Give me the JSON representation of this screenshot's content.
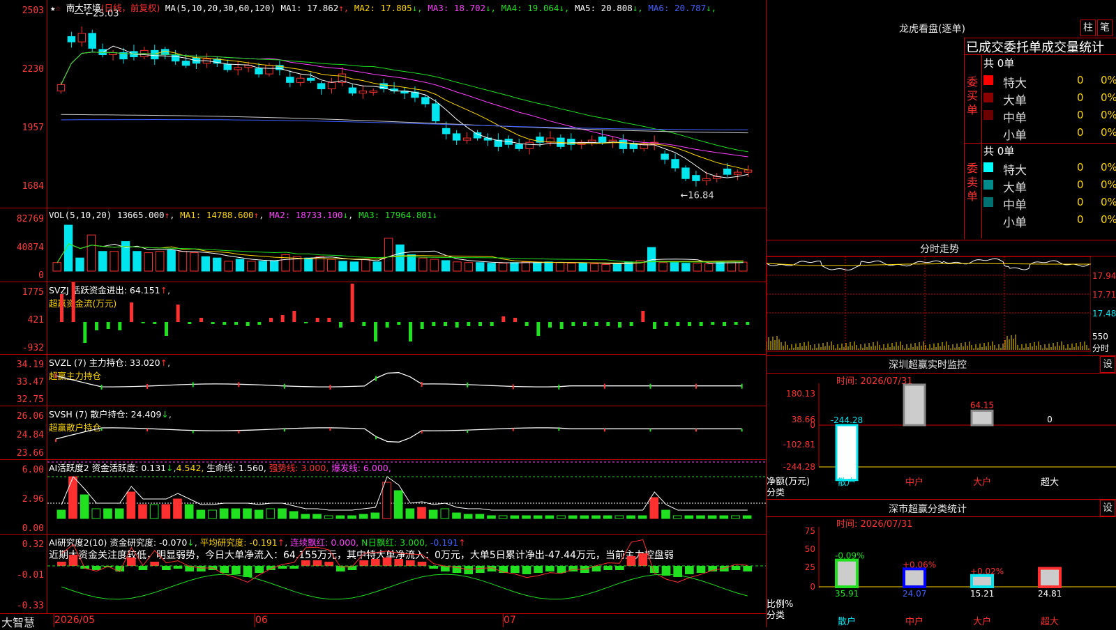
{
  "stock": {
    "name": "南大环境",
    "period": "(日线，前复权)"
  },
  "main_header": {
    "ma_prefix": "MA(5,10,20,30,60,120)",
    "ma": [
      {
        "label": "MA1:",
        "value": "17.862",
        "arrow": "↑",
        "color": "#ffffff"
      },
      {
        "label": "MA2:",
        "value": "17.805",
        "arrow": "↓",
        "color": "#ffd700"
      },
      {
        "label": "MA3:",
        "value": "18.702",
        "arrow": "↓",
        "color": "#ff40ff"
      },
      {
        "label": "MA4:",
        "value": "19.064",
        "arrow": "↓",
        "color": "#20e020"
      },
      {
        "label": "MA5:",
        "value": "20.808",
        "arrow": "↓",
        "color": "#ffffff"
      },
      {
        "label": "MA6:",
        "value": "20.787",
        "arrow": "↓",
        "color": "#4060ff"
      }
    ],
    "high_mark": "25.03",
    "low_mark": "16.84"
  },
  "price_axis": [
    "2503",
    "2230",
    "1957",
    "1684"
  ],
  "vol_header": {
    "prefix": "VOL(5,10,20)",
    "value": "13665.000",
    "ma1": "14788.600",
    "ma2": "18733.100",
    "ma3": "17964.801"
  },
  "vol_axis": [
    "82769",
    "40874",
    "0"
  ],
  "svzj": {
    "line1": "SVZJ  活跃资金进出: 64.151",
    "line2": "超赢资金流(万元)",
    "axis": [
      "1775",
      "421",
      "-932"
    ]
  },
  "svzl": {
    "line1": "SVZL (7) 主力持仓: 33.020",
    "line2": "超赢主力持仓",
    "axis": [
      "34.19",
      "33.47",
      "32.75"
    ]
  },
  "svsh": {
    "line1": "SVSH (7) 散户持仓: 24.409",
    "line2": "超赢散户持仓",
    "axis": [
      "26.06",
      "24.84",
      "23.66"
    ]
  },
  "ai_active": {
    "prefix": "AI活跃度2 资金活跃度: 0.131",
    "v2": "4.542",
    "life": "生命线: 1.560,",
    "strong": "强势线: 3.000,",
    "burst": "爆发线: 6.000,",
    "axis": [
      "6.00",
      "2.96",
      "0.00"
    ]
  },
  "ai_research": {
    "prefix": "AI研究度2(10) 资金研究度: -0.070",
    "avg": "平均研究度: -0.191",
    "cont": "连续飘红: 0.000,",
    "nred": "N日飘红: 3.000,",
    "last": "-0.191",
    "note": "近期大资金关注度较低，明显弱势，今日大单净流入：64.155万元，其中特大单净流入：0万元，大单5日累计净出-47.44万元，当前主力控盘弱",
    "axis": [
      "0.32",
      "-0.01",
      "-0.33"
    ]
  },
  "bottom_bar": {
    "brand": "大智慧",
    "dates": [
      "2026/05",
      "06",
      "07"
    ]
  },
  "dragon": {
    "title": "龙虎看盘(逐单)",
    "btn1": "柱",
    "btn2": "笔",
    "header": "已成交委托单成交量统计",
    "buy_label": "委买单",
    "sell_label": "委卖单",
    "buy_total": "共 0单",
    "sell_total": "共 0单",
    "buy_rows": [
      {
        "name": "特大",
        "count": "0",
        "pct": "0%",
        "color": "#ff0000"
      },
      {
        "name": "大单",
        "count": "0",
        "pct": "0%",
        "color": "#8b0000"
      },
      {
        "name": "中单",
        "count": "0",
        "pct": "0%",
        "color": "#6b0000"
      },
      {
        "name": "小单",
        "count": "0",
        "pct": "0%",
        "color": ""
      }
    ],
    "sell_rows": [
      {
        "name": "特大",
        "count": "0",
        "pct": "0%",
        "color": "#00ffff"
      },
      {
        "name": "大单",
        "count": "0",
        "pct": "0%",
        "color": "#008b8b"
      },
      {
        "name": "中单",
        "count": "0",
        "pct": "0%",
        "color": "#007070"
      },
      {
        "name": "小单",
        "count": "0",
        "pct": "0%",
        "color": ""
      }
    ]
  },
  "intraday": {
    "title": "分时走势",
    "axis": [
      "17.94",
      "17.71",
      "17.48"
    ],
    "vol_label": "550",
    "vol_unit": "分时"
  },
  "sz_monitor": {
    "title": "深圳超赢实时监控",
    "btn": "设",
    "time": "时间: 2026/07/31",
    "axis": [
      "180.13",
      "38.66",
      "0",
      "-102.81",
      "-244.28"
    ],
    "ylabel": "净额(万元)",
    "xlabel_prefix": "分类",
    "cats": [
      "散户",
      "中户",
      "大户",
      "超大"
    ],
    "values": [
      -244.28,
      180.13,
      64.15,
      0
    ],
    "value_labels": [
      "-244.28",
      "180.13",
      "64.15",
      "0"
    ]
  },
  "sz_class": {
    "title": "深市超赢分类统计",
    "btn": "设",
    "time": "时间: 2026/07/31",
    "axis": [
      "75",
      "50",
      "25",
      "0"
    ],
    "ylabel": "比例%",
    "xlabel_prefix": "分类",
    "cats": [
      "散户",
      "中户",
      "大户",
      "超大"
    ],
    "values": [
      35.91,
      24.07,
      15.21,
      24.81
    ],
    "value_labels": [
      "35.91",
      "24.07",
      "15.21",
      "24.81"
    ],
    "changes": [
      "-0.09%",
      "+0.06%",
      "+0.02%",
      ""
    ]
  },
  "chart_data": [
    {
      "type": "candlestick",
      "title": "南大环境",
      "ylabel": "",
      "ylim": [
        16.84,
        25.03
      ],
      "high": 25.03,
      "low": 16.84,
      "close": [
        21.7,
        23.7,
        24.1,
        23.4,
        23.1,
        23.2,
        22.9,
        23.0,
        23.3,
        22.9,
        23.1,
        22.8,
        22.6,
        22.7,
        22.9,
        22.7,
        22.4,
        22.5,
        22.6,
        22.2,
        22.6,
        22.4,
        21.8,
        22.0,
        21.9,
        21.5,
        21.8,
        22.2,
        21.3,
        21.4,
        21.4,
        21.5,
        21.4,
        21.3,
        21.1,
        20.8,
        20.0,
        19.4,
        19.1,
        19.2,
        19.2,
        19.1,
        18.8,
        18.9,
        18.7,
        19.0,
        19.0,
        19.2,
        18.8,
        18.9,
        19.0,
        19.1,
        19.0,
        19.1,
        18.7,
        18.7,
        18.9,
        19.0,
        18.2,
        17.8,
        17.3,
        17.2,
        17.3,
        17.4,
        17.5,
        17.6,
        17.7
      ]
    },
    {
      "type": "bar",
      "title": "VOL",
      "values": [
        13000,
        70000,
        20000,
        55000,
        30000,
        30000,
        45000,
        30000,
        28000,
        30000,
        32000,
        30000,
        28000,
        22000,
        20000,
        15000,
        18000,
        15000,
        15000,
        16000,
        25000,
        22000,
        20000,
        22000,
        18000,
        15000,
        14000,
        18000,
        14000,
        50000,
        40000,
        25000,
        20000,
        18000,
        16000,
        14000,
        13000,
        13000,
        12000,
        12000,
        13000,
        14000,
        13000,
        14000,
        13000,
        12000,
        12000,
        11000,
        10000,
        11000,
        14000,
        16000,
        36000,
        13000,
        13000,
        12000,
        12000,
        11000,
        14000,
        14000,
        13665
      ]
    }
  ]
}
